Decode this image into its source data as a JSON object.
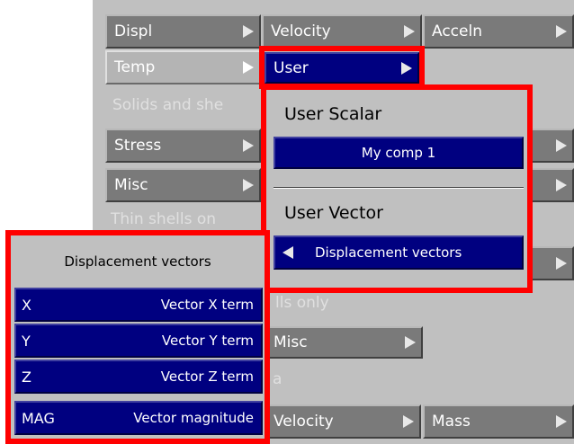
{
  "top_row": {
    "displ": "Displ",
    "velocity": "Velocity",
    "acceln": "Acceln"
  },
  "second_row": {
    "temp": "Temp",
    "user": "User"
  },
  "sections": {
    "solids_and_shells": "Solids and she",
    "thin_shells": "Thin shells on",
    "shells_only_fragment": "lls only",
    "a_fragment": "a"
  },
  "left_buttons": {
    "stress": "Stress",
    "misc": "Misc"
  },
  "bottom_buttons": {
    "misc": "Misc",
    "velocity": "Velocity",
    "mass": "Mass"
  },
  "user_popup": {
    "scalar_title": "User Scalar",
    "scalar_item": "My comp 1",
    "vector_title": "User Vector",
    "vector_item": "Displacement vectors"
  },
  "vector_popup": {
    "title": "Displacement vectors",
    "rows": [
      {
        "key": "X",
        "label": "Vector X term"
      },
      {
        "key": "Y",
        "label": "Vector Y term"
      },
      {
        "key": "Z",
        "label": "Vector Z term"
      },
      {
        "key": "MAG",
        "label": "Vector magnitude"
      }
    ]
  },
  "colors": {
    "panel_grey": "#c0c0c0",
    "button_grey": "#7a7a7a",
    "navy": "#000080",
    "highlight_red": "#ff0000"
  }
}
